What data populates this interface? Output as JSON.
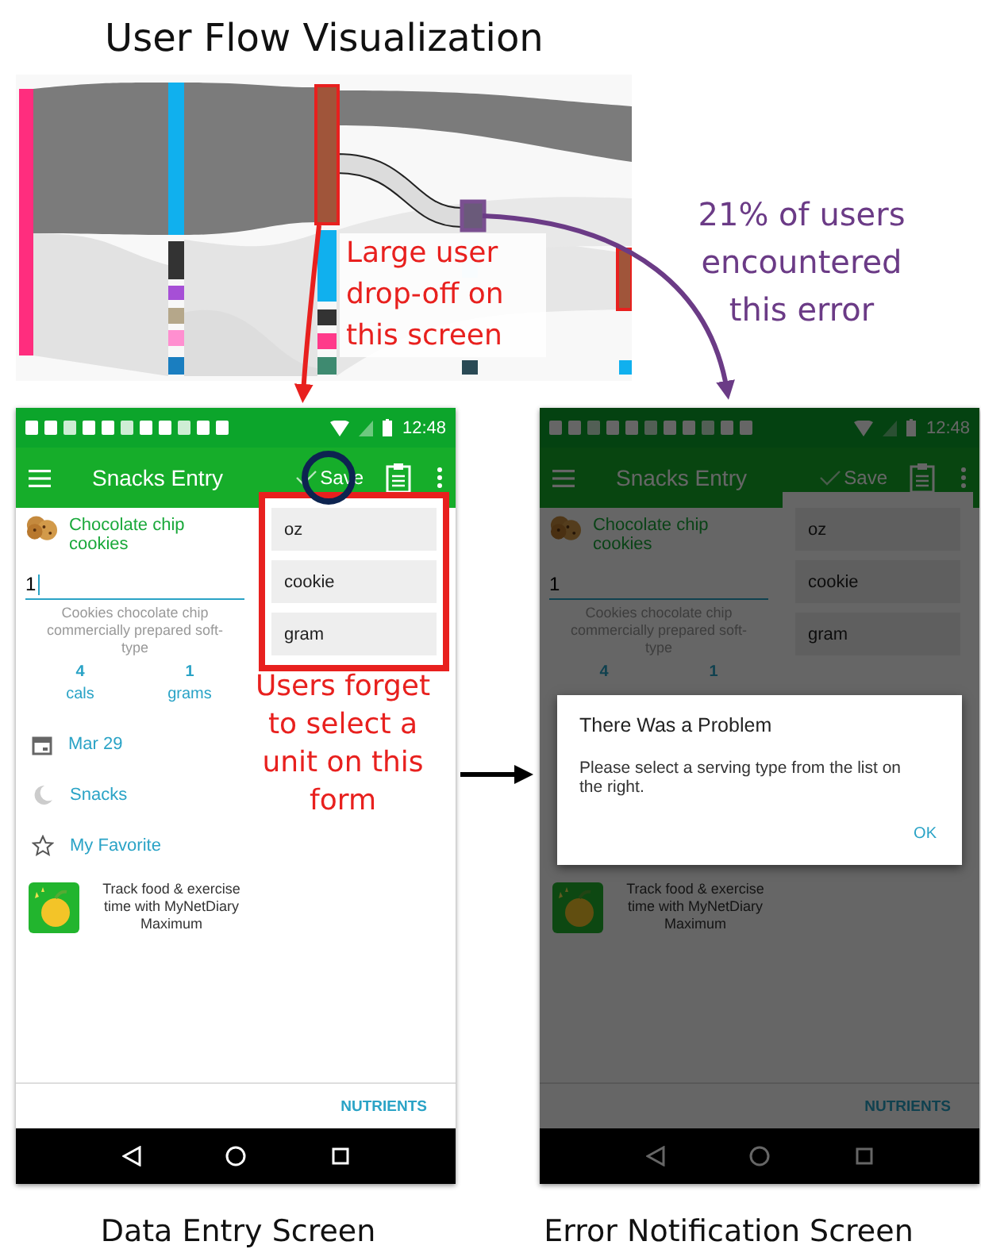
{
  "title": "User Flow Visualization",
  "annotations": [
    {
      "kind": "dropoff",
      "text": "Large user drop-off on this screen",
      "color": "#e8201e"
    },
    {
      "kind": "error",
      "text": "21% of users encountered this error",
      "color": "#6b3b86"
    },
    {
      "kind": "unit",
      "text": "Users forget to select a unit on this form",
      "color": "#e8201e"
    }
  ],
  "screens": [
    {
      "caption": "Data Entry Screen",
      "time": "12:48",
      "app_title": "Snacks Entry",
      "save": "Save",
      "save_circled": true,
      "food": "Chocolate chip cookies",
      "quantity": "1",
      "focused": true,
      "description": "Cookies chocolate chip commercially prepared soft-type",
      "stats": [
        {
          "value": "4",
          "label": "cals"
        },
        {
          "value": "1",
          "label": "grams"
        }
      ],
      "units": [
        "oz",
        "cookie",
        "gram"
      ],
      "units_highlighted": true,
      "details": [
        {
          "kind": "date",
          "label": "Mar 29"
        },
        {
          "kind": "meal",
          "label": "Snacks"
        },
        {
          "kind": "favorite",
          "label": "My Favorite"
        }
      ],
      "promo": "Track food & exercise time with MyNetDiary Maximum",
      "footer_button": "NUTRIENTS"
    },
    {
      "caption": "Error Notification Screen",
      "time": "12:48",
      "app_title": "Snacks Entry",
      "save": "Save",
      "food": "Chocolate chip cookies",
      "quantity": "1",
      "focused": false,
      "description": "Cookies chocolate chip commercially prepared soft-type",
      "stats": [
        {
          "value": "4"
        },
        {
          "value": "1"
        }
      ],
      "units": [
        "oz",
        "cookie",
        "gram"
      ],
      "units_highlighted": false,
      "promo": "Track food & exercise time with MyNetDiary Maximum",
      "footer_button": "NUTRIENTS",
      "dialog": {
        "title": "There Was a Problem",
        "message": "Please select a serving type from the list on the right.",
        "button": "OK"
      }
    }
  ]
}
